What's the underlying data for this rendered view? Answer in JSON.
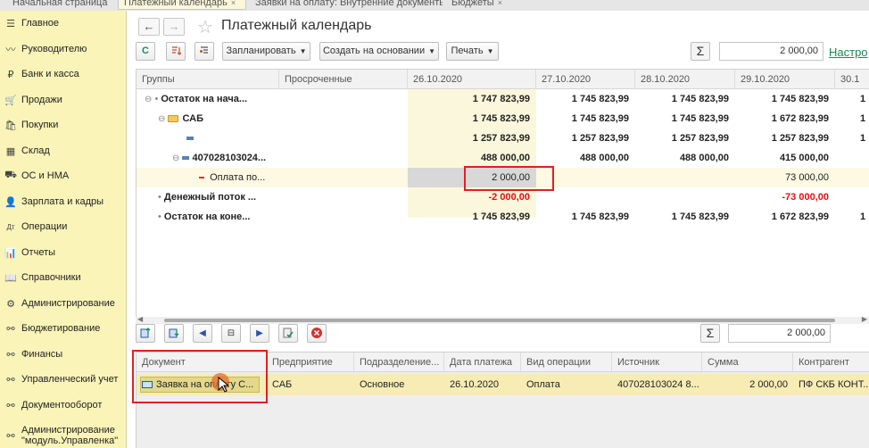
{
  "tabs": [
    {
      "label": "Начальная страница",
      "close": ""
    },
    {
      "label": "Платежный календарь",
      "close": "×"
    },
    {
      "label": "Заявки на оплату: Внутренние документы",
      "close": "×"
    },
    {
      "label": "Бюджеты",
      "close": "×"
    }
  ],
  "sidebar": {
    "items": [
      {
        "label": "Главное",
        "icon": "list-icon",
        "glyph": "☰"
      },
      {
        "label": "Руководителю",
        "icon": "chart-line-icon",
        "glyph": "〰"
      },
      {
        "label": "Банк и касса",
        "icon": "ruble-icon",
        "glyph": "₽"
      },
      {
        "label": "Продажи",
        "icon": "cart-icon",
        "glyph": "🛒"
      },
      {
        "label": "Покупки",
        "icon": "basket-icon",
        "glyph": "🛍"
      },
      {
        "label": "Склад",
        "icon": "warehouse-icon",
        "glyph": "▦"
      },
      {
        "label": "ОС и НМА",
        "icon": "truck-icon",
        "glyph": "⛟"
      },
      {
        "label": "Зарплата и кадры",
        "icon": "person-icon",
        "glyph": "👤"
      },
      {
        "label": "Операции",
        "icon": "dt-kt-icon",
        "glyph": "Дт"
      },
      {
        "label": "Отчеты",
        "icon": "bar-chart-icon",
        "glyph": "📊"
      },
      {
        "label": "Справочники",
        "icon": "book-icon",
        "glyph": "📖"
      },
      {
        "label": "Администрирование",
        "icon": "gear-icon",
        "glyph": "⚙"
      },
      {
        "label": "Бюджетирование",
        "icon": "link-icon",
        "glyph": "⚯"
      },
      {
        "label": "Финансы",
        "icon": "link-icon",
        "glyph": "⚯"
      },
      {
        "label": "Управленческий учет",
        "icon": "link-icon",
        "glyph": "⚯"
      },
      {
        "label": "Документооборот",
        "icon": "link-icon",
        "glyph": "⚯"
      },
      {
        "label": "Администрирование \"модуль.Управленка\"",
        "icon": "link-icon",
        "glyph": "⚯"
      }
    ]
  },
  "header": {
    "back": "←",
    "forward": "→",
    "star": "☆",
    "title": "Платежный календарь"
  },
  "toolbar": {
    "refresh": "C",
    "plan_label": "Запланировать",
    "create_label": "Создать на основании",
    "print_label": "Печать",
    "sigma": "Σ",
    "sum_value": "2 000,00",
    "settings_link": "Настро"
  },
  "grid": {
    "columns": [
      "Группы",
      "Просроченные",
      "26.10.2020",
      "27.10.2020",
      "28.10.2020",
      "29.10.2020",
      "30.1"
    ],
    "rows": [
      {
        "name": "Остаток на нача...",
        "bold": true,
        "values": [
          "",
          "1 747 823,99",
          "1 745 823,99",
          "1 745 823,99",
          "1 745 823,99",
          "1"
        ]
      },
      {
        "name": "САБ",
        "bold": true,
        "values": [
          "",
          "1 745 823,99",
          "1 745 823,99",
          "1 745 823,99",
          "1 672 823,99",
          "1"
        ]
      },
      {
        "name": "",
        "bold": true,
        "values": [
          "",
          "1 257 823,99",
          "1 257 823,99",
          "1 257 823,99",
          "1 257 823,99",
          "1"
        ]
      },
      {
        "name": "407028103024...",
        "bold": true,
        "values": [
          "",
          "488 000,00",
          "488 000,00",
          "488 000,00",
          "415 000,00",
          ""
        ]
      },
      {
        "name": "Оплата по...",
        "bold": false,
        "values": [
          "",
          "2 000,00",
          "",
          "",
          "73 000,00",
          ""
        ]
      },
      {
        "name": "Денежный поток ...",
        "bold": true,
        "values": [
          "",
          "-2 000,00",
          "",
          "",
          "-73 000,00",
          ""
        ]
      },
      {
        "name": "Остаток на коне...",
        "bold": true,
        "values": [
          "",
          "1 745 823,99",
          "1 745 823,99",
          "1 745 823,99",
          "1 672 823,99",
          "1"
        ]
      }
    ]
  },
  "bottom_toolbar": {
    "sigma": "Σ",
    "sum_value": "2 000,00"
  },
  "documents": {
    "columns": [
      "Документ",
      "Предприятие",
      "Подразделение...",
      "Дата платежа",
      "Вид операции",
      "Источник",
      "Сумма",
      "Контрагент"
    ],
    "row": [
      "Заявка на оплату С...",
      "САБ",
      "Основное",
      "26.10.2020",
      "Оплата",
      "407028103024 8...",
      "2 000,00",
      "ПФ СКБ КОНТ..."
    ]
  }
}
